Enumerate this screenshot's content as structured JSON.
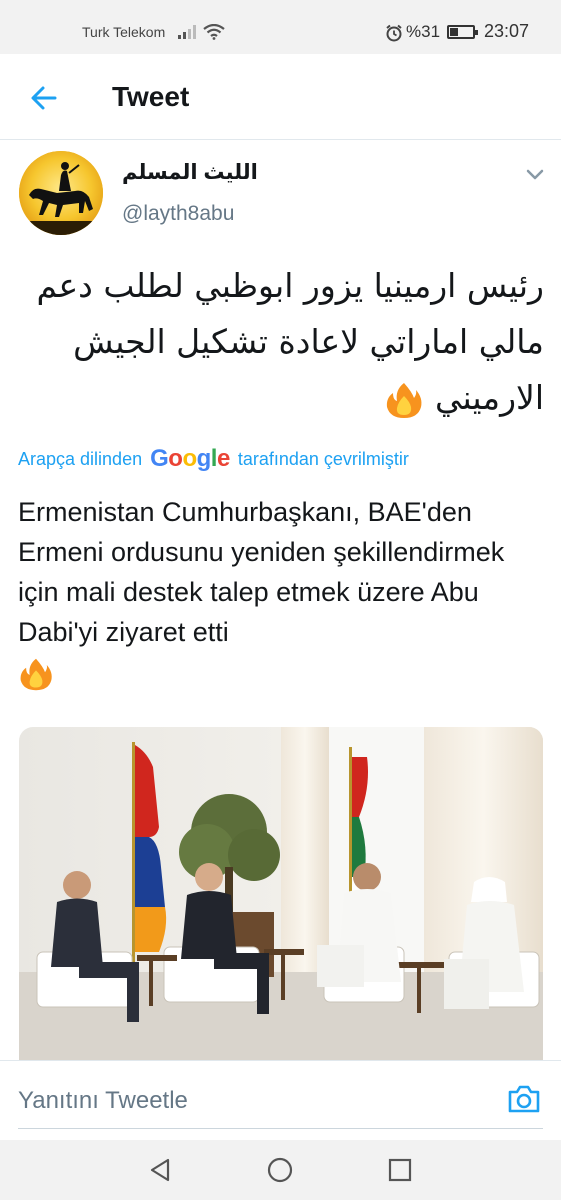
{
  "status_bar": {
    "carrier": "Turk Telekom",
    "battery": "%31",
    "time": "23:07"
  },
  "header": {
    "title": "Tweet"
  },
  "tweet": {
    "author_name": "الليث المسلم",
    "author_handle": "@layth8abu",
    "text_ar": "رئيس ارمينيا يزور ابوظبي لطلب دعم مالي اماراتي لاعادة تشكيل الجيش الارميني",
    "translation": {
      "prefix": "Arapça dilinden",
      "brand": "Google",
      "suffix": "tarafından çevrilmiştir"
    },
    "text_tr": "Ermenistan Cumhurbaşkanı, BAE'den Ermeni ordusunu yeniden şekillendirmek için mali destek talep etmek üzere Abu Dabi'yi ziyaret etti"
  },
  "reply": {
    "placeholder": "Yanıtını Tweetle"
  },
  "colors": {
    "accent": "#1da1f2",
    "text": "#14171a",
    "secondary": "#657786"
  }
}
